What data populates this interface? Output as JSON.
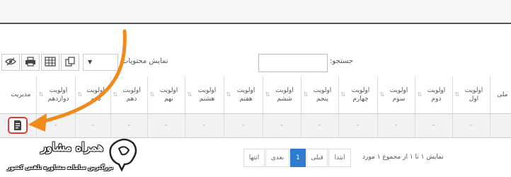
{
  "toolbar": {
    "search_label": "جستجو:",
    "search_value": "",
    "show_contents_label": "نمایش محتویات",
    "select_value": "",
    "icons": [
      "eye-off-icon",
      "print-icon",
      "table-icon",
      "copy-icon"
    ]
  },
  "table": {
    "columns": [
      "ملی",
      "اولویت اول",
      "اولویت دوم",
      "اولویت سوم",
      "اولویت چهارم",
      "اولویت پنجم",
      "اولویت ششم",
      "اولویت هفتم",
      "اولویت هشتم",
      "اولویت نهم",
      "اولویت دهم",
      "اولویت دهم",
      "اولویت دوازدهم",
      "مدیریت"
    ],
    "row": [
      "",
      "-",
      "-",
      "-",
      "-",
      "-",
      "-",
      "-",
      "-",
      "-",
      "-",
      "-",
      "-"
    ]
  },
  "pagination": {
    "info": "نمایش ۱ تا ۱ از مجموع ۱ مورد",
    "first": "ابتدا",
    "prev": "قبلی",
    "current": "1",
    "next": "بعدی",
    "last": "انتها"
  },
  "branding": {
    "name": "همراه مشاور",
    "tagline": "بزرگترین سامانه مشاوره تلفنی کشور"
  },
  "colors": {
    "arrow": "#f08a1c",
    "highlight": "#e53935",
    "active_page": "#2e7bcf"
  }
}
